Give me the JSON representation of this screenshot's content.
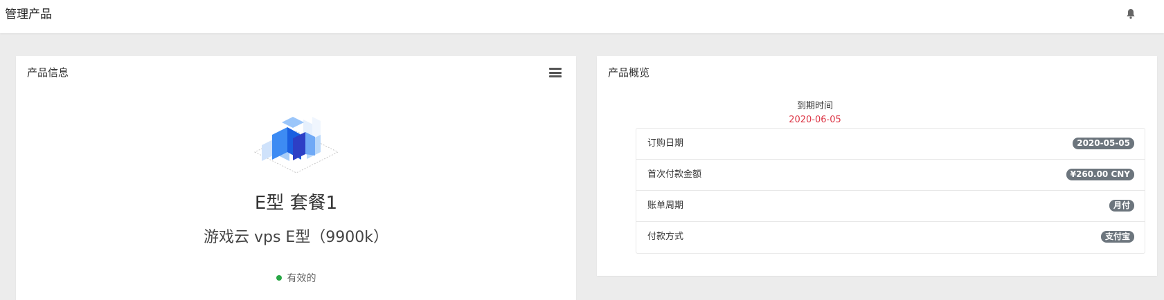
{
  "header": {
    "title": "管理产品",
    "bell_icon": "bell-icon"
  },
  "product_info": {
    "panel_title": "产品信息",
    "menu_icon": "hamburger-menu-icon",
    "logo_icon": "cloud-cube-logo",
    "plan_name": "E型 套餐1",
    "product_name": "游戏云 vps E型（9900k）",
    "status": "有效的",
    "status_color": "#28a745"
  },
  "product_overview": {
    "panel_title": "产品概览",
    "expiry_label": "到期时间",
    "expiry_value": "2020-06-05",
    "expiry_color": "#dc3545",
    "items": [
      {
        "label": "订购日期",
        "value": "2020-05-05"
      },
      {
        "label": "首次付款金额",
        "value": "¥260.00 CNY"
      },
      {
        "label": "账单周期",
        "value": "月付"
      },
      {
        "label": "付款方式",
        "value": "支付宝"
      }
    ]
  }
}
